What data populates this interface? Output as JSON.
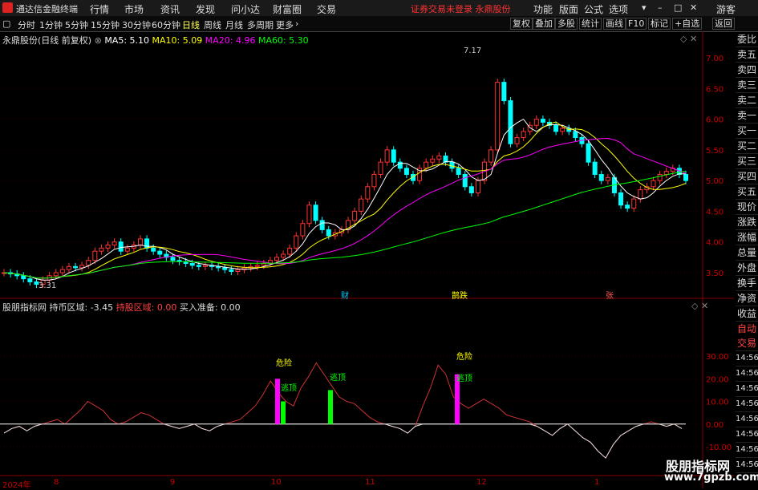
{
  "titlebar": {
    "app_name": "通达信金融终端",
    "menus": [
      "行情",
      "市场",
      "资讯",
      "发现",
      "问小达",
      "财富圈",
      "交易"
    ],
    "warning": "证券交易未登录  永鼎股份",
    "right_menus": [
      "功能",
      "版面",
      "公式",
      "选项"
    ],
    "guest": "游客"
  },
  "toolbar": {
    "periods": [
      "分时",
      "1分钟",
      "5分钟",
      "15分钟",
      "30分钟",
      "60分钟",
      "日线",
      "周线",
      "月线",
      "多周期",
      "更多"
    ],
    "active_period": "日线",
    "right_buttons": [
      "复权",
      "叠加",
      "多股",
      "统计",
      "画线",
      "F10",
      "标记",
      "+自选",
      "返回"
    ]
  },
  "main_chart": {
    "stock_title": "永鼎股份(日线 前复权)",
    "ma5": "MA5: 5.10",
    "ma10": "MA10: 5.09",
    "ma20": "MA20: 4.96",
    "ma60": "MA60: 5.30",
    "high_label": "7.17",
    "low_label": "3.31",
    "y_ticks": [
      "7.00",
      "6.50",
      "6.00",
      "5.50",
      "5.00",
      "4.50",
      "4.00",
      "3.50"
    ],
    "events": [
      "财",
      "鹊跌",
      "张"
    ]
  },
  "indicator": {
    "name": "股朋指标网",
    "line1": "持币区域: -3.45",
    "line2": "持股区域: 0.00",
    "line3": "买入准备: 0.00",
    "y_ticks": [
      "30.00",
      "20.00",
      "10.00",
      "0.00",
      "-10.00"
    ],
    "labels": [
      "危险",
      "逃顶",
      "逃顶",
      "危险",
      "逃顶"
    ]
  },
  "x_axis": [
    "2024年",
    "8",
    "9",
    "10",
    "11",
    "12",
    "1"
  ],
  "side_panel": {
    "items": [
      "委比",
      "卖五",
      "卖四",
      "卖三",
      "卖二",
      "卖一",
      "买一",
      "买二",
      "买三",
      "买四",
      "买五",
      "现价",
      "涨跌",
      "涨幅",
      "总量",
      "外盘",
      "换手",
      "净资",
      "收益"
    ],
    "auto_trade": "自动交易",
    "times": [
      "14:56",
      "14:56",
      "14:56",
      "14:56",
      "14:56",
      "14:56",
      "14:56",
      "14:56"
    ]
  },
  "watermark": {
    "name": "股朋指标网",
    "url": "www.7gpzb.com"
  },
  "colors": {
    "bg": "#000000",
    "up": "#ff3333",
    "down": "#00ffff",
    "ma5": "#ffffff",
    "ma10": "#ffff00",
    "ma20": "#ff00ff",
    "ma60": "#00ff00"
  }
}
